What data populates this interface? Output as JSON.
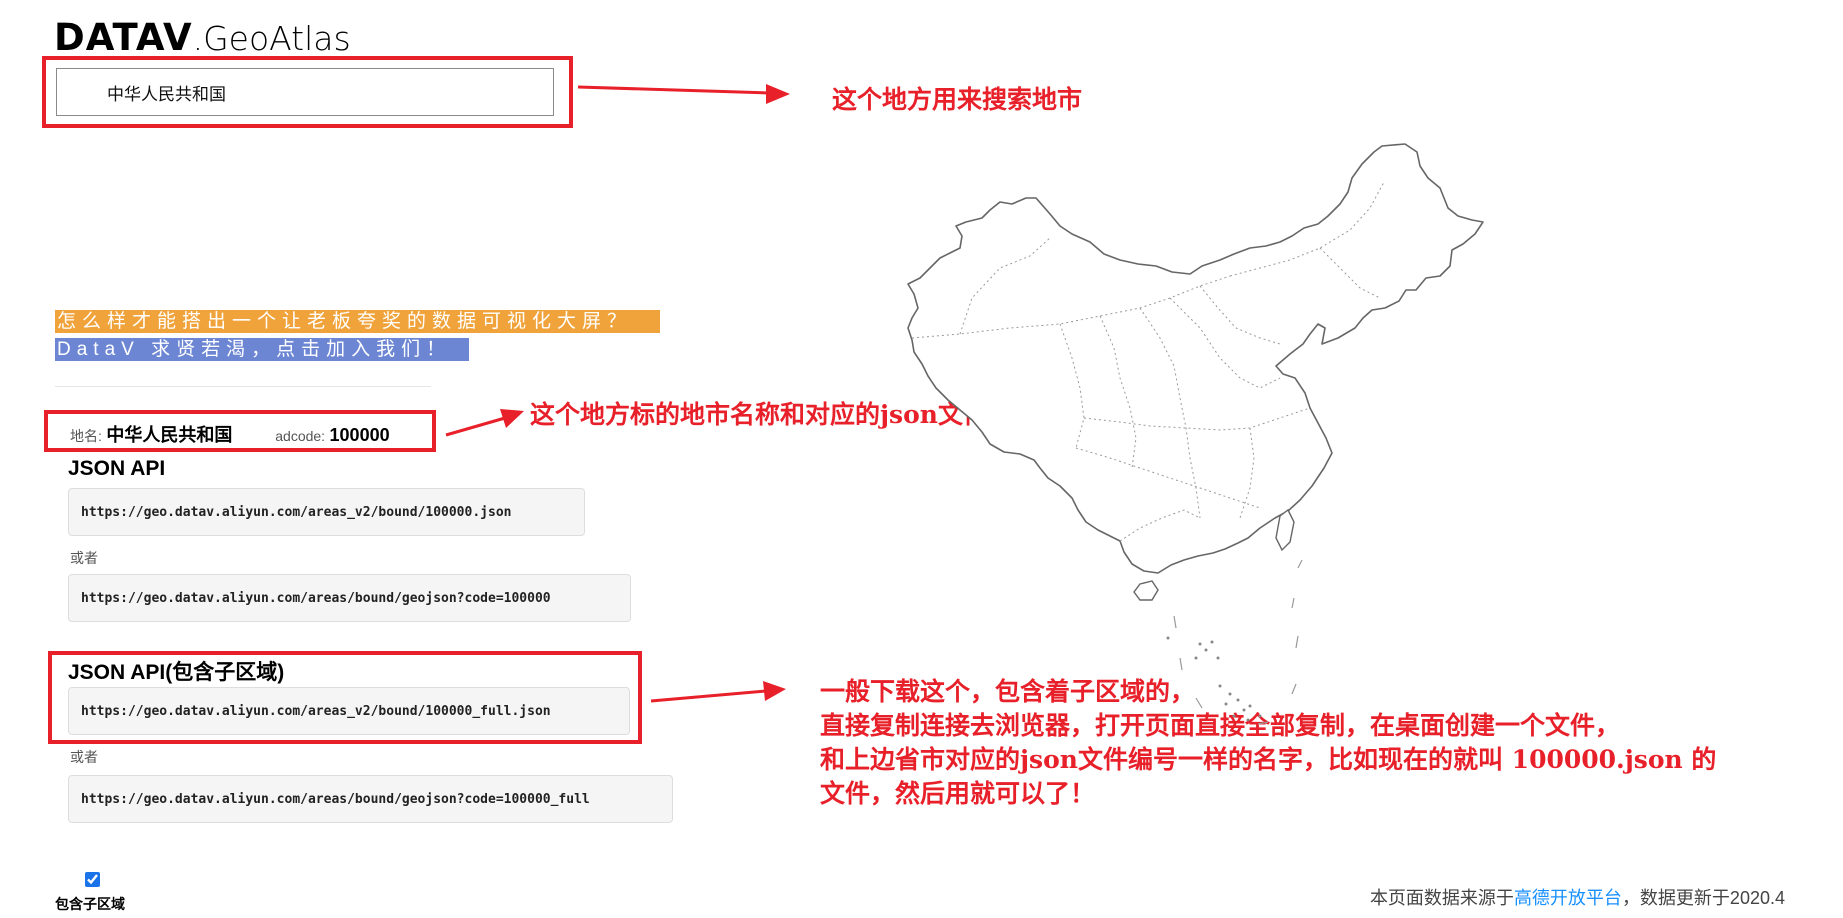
{
  "logo": {
    "bold": "DATAV",
    "thin": ".GeoAtlas"
  },
  "search": {
    "value": "中华人民共和国",
    "placeholder": ""
  },
  "promo": {
    "line1": "怎么样才能搭出一个让老板夸奖的数据可视化大屏？",
    "line2": "DataV 求贤若渴，点击加入我们！"
  },
  "meta": {
    "name_label": "地名:",
    "name_value": "中华人民共和国",
    "adcode_label": "adcode:",
    "adcode_value": "100000"
  },
  "api": {
    "heading": "JSON API",
    "url1": "https://geo.datav.aliyun.com/areas_v2/bound/100000.json",
    "or1": "或者",
    "url2": "https://geo.datav.aliyun.com/areas/bound/geojson?code=100000"
  },
  "api_full": {
    "heading": "JSON API(包含子区域)",
    "url1": "https://geo.datav.aliyun.com/areas_v2/bound/100000_full.json",
    "or1": "或者",
    "url2": "https://geo.datav.aliyun.com/areas/bound/geojson?code=100000_full"
  },
  "checkbox": {
    "label": "包含子区域",
    "checked": true
  },
  "annotations": {
    "search_note": "这个地方用来搜索地市",
    "name_note": "这个地方标的地市名称和对应的json文件编号",
    "download_note_lines": [
      "一般下载这个，包含着子区域的，",
      "直接复制连接去浏览器，打开页面直接全部复制，在桌面创建一个文件，",
      "和上边省市对应的json文件编号一样的名字，比如现在的就叫 100000.json 的",
      "文件，然后用就可以了！"
    ]
  },
  "footer": {
    "prefix": "本页面数据来源于",
    "link": "高德开放平台",
    "suffix": "，数据更新于2020.4"
  },
  "colors": {
    "annotation_red": "#e8202a",
    "promo_orange": "#f1a33b",
    "promo_blue": "#6c86d3",
    "link_blue": "#1890ff"
  }
}
